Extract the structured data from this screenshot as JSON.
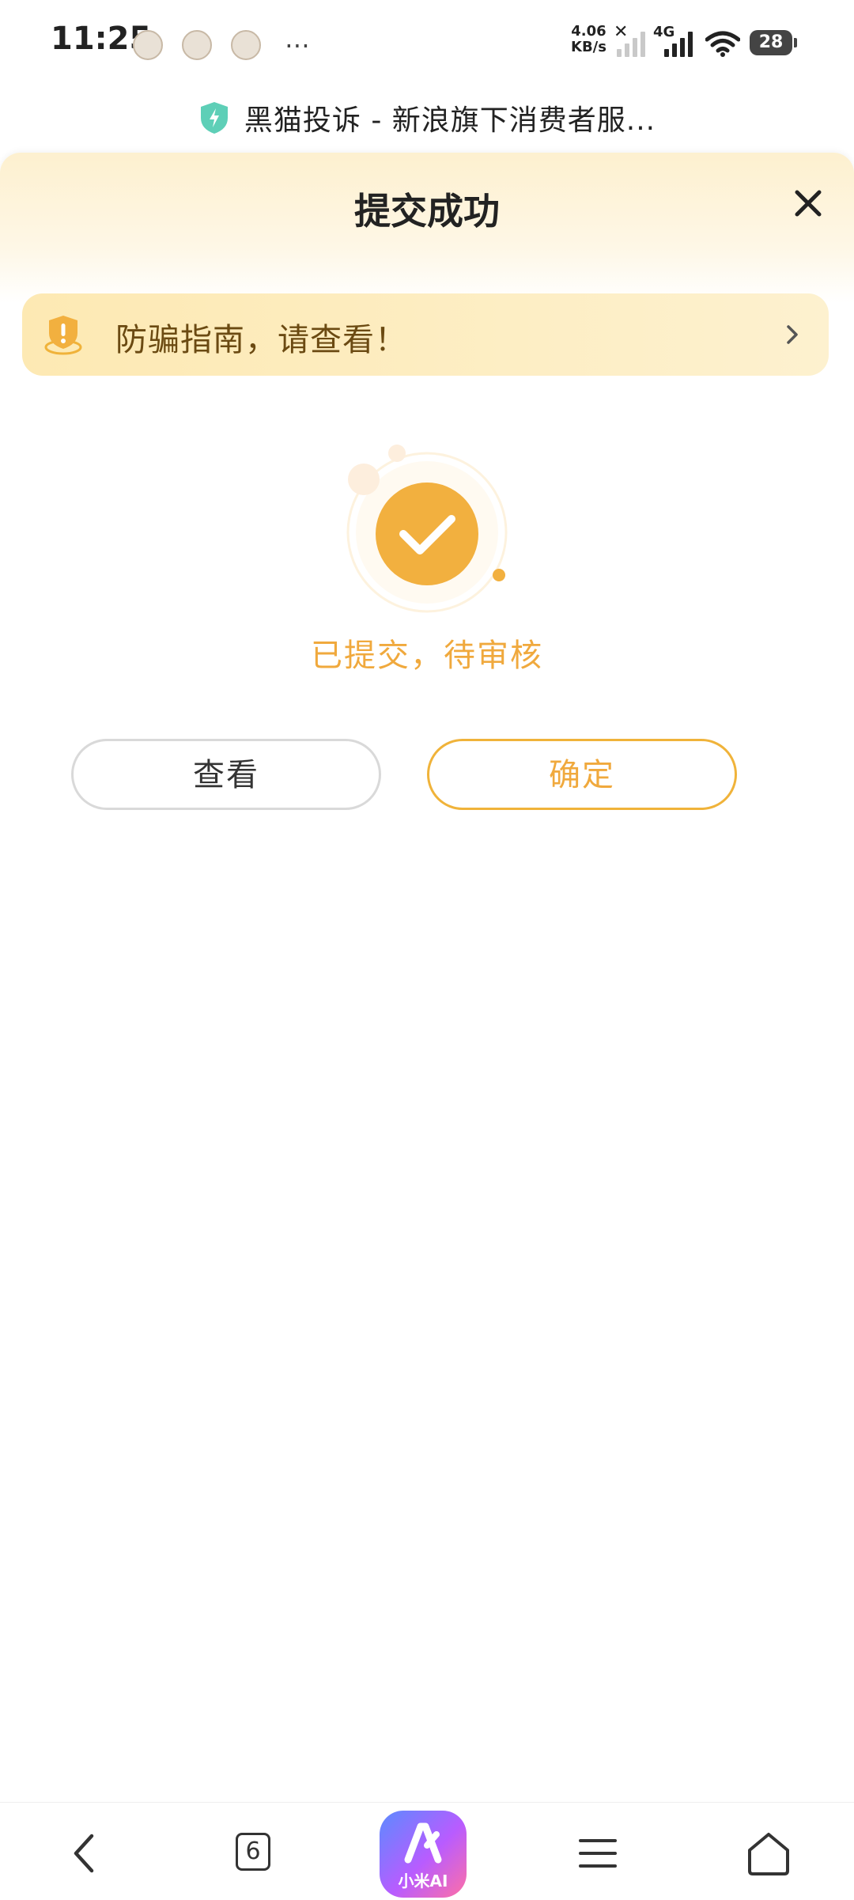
{
  "status_bar": {
    "time": "11:25",
    "net_speed_value": "4.06",
    "net_speed_unit": "KB/s",
    "network_type": "4G",
    "battery": "28"
  },
  "address_bar": {
    "page_title": "黑猫投诉 - 新浪旗下消费者服..."
  },
  "dialog": {
    "title": "提交成功",
    "guide_banner": "防骗指南，请查看！",
    "status_text": "已提交，待审核",
    "view_button": "查看",
    "confirm_button": "确定"
  },
  "bottom_nav": {
    "tab_count": "6",
    "ai_label": "小米AI"
  },
  "colors": {
    "accent": "#f0a93d",
    "accent_check": "#f2b03f",
    "banner_bg": "#fde9b3",
    "banner_text": "#6b4a12"
  }
}
